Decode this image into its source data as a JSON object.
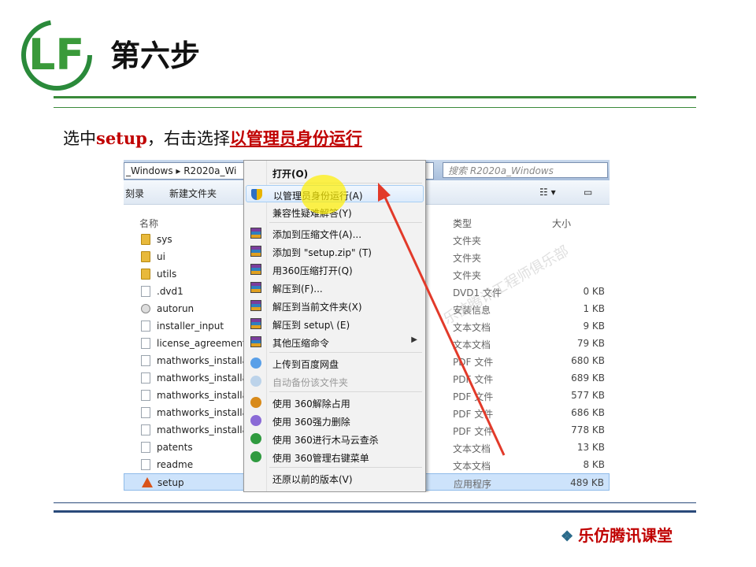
{
  "slide": {
    "title": "第六步",
    "logo_letters": "LF",
    "instruction_prefix": "选中",
    "instruction_keyword": "setup",
    "instruction_middle": "，右击选择",
    "instruction_link": "以管理员身份运行",
    "brand": "乐仿腾讯课堂",
    "watermark": "乐仿腾讯工程师俱乐部"
  },
  "explorer": {
    "address": "_Windows ▸ R2020a_Wi",
    "search_placeholder": "搜索 R2020a_Windows",
    "toolbar": {
      "burn": "刻录",
      "new_folder": "新建文件夹"
    },
    "columns": {
      "name": "名称",
      "type": "类型",
      "size": "大小"
    },
    "files": [
      {
        "name": "sys",
        "type": "文件夹",
        "size": "",
        "icon": "folder"
      },
      {
        "name": "ui",
        "type": "文件夹",
        "size": "",
        "icon": "folder"
      },
      {
        "name": "utils",
        "type": "文件夹",
        "size": "",
        "icon": "folder"
      },
      {
        "name": ".dvd1",
        "type": "DVD1 文件",
        "size": "0 KB",
        "icon": "file"
      },
      {
        "name": "autorun",
        "type": "安装信息",
        "size": "1 KB",
        "icon": "gear"
      },
      {
        "name": "installer_input",
        "type": "文本文档",
        "size": "9 KB",
        "icon": "file"
      },
      {
        "name": "license_agreement",
        "type": "文本文档",
        "size": "79 KB",
        "icon": "file"
      },
      {
        "name": "mathworks_installa",
        "type": "PDF 文件",
        "size": "680 KB",
        "icon": "file"
      },
      {
        "name": "mathworks_installa",
        "type": "PDF 文件",
        "size": "689 KB",
        "icon": "file"
      },
      {
        "name": "mathworks_installa",
        "type": "PDF 文件",
        "size": "577 KB",
        "icon": "file"
      },
      {
        "name": "mathworks_installa",
        "type": "PDF 文件",
        "size": "686 KB",
        "icon": "file"
      },
      {
        "name": "mathworks_installa",
        "type": "PDF 文件",
        "size": "778 KB",
        "icon": "file"
      },
      {
        "name": "patents",
        "type": "文本文档",
        "size": "13 KB",
        "icon": "file"
      },
      {
        "name": "readme",
        "type": "文本文档",
        "size": "8 KB",
        "icon": "file"
      },
      {
        "name": "setup",
        "type": "应用程序",
        "size": "489 KB",
        "icon": "matlab"
      }
    ]
  },
  "context_menu": {
    "items": [
      {
        "label": "打开(O)",
        "icon": "",
        "bold": true
      },
      {
        "label": "以管理员身份运行(A)",
        "icon": "shield",
        "highlight": true
      },
      {
        "label": "兼容性疑难解答(Y)",
        "icon": ""
      },
      {
        "label": "添加到压缩文件(A)...",
        "icon": "rar"
      },
      {
        "label": "添加到 \"setup.zip\" (T)",
        "icon": "rar"
      },
      {
        "label": "用360压缩打开(Q)",
        "icon": "rar"
      },
      {
        "label": "解压到(F)...",
        "icon": "rar"
      },
      {
        "label": "解压到当前文件夹(X)",
        "icon": "rar"
      },
      {
        "label": "解压到 setup\\ (E)",
        "icon": "rar"
      },
      {
        "label": "其他压缩命令",
        "icon": "rar",
        "submenu": true
      },
      {
        "label": "上传到百度网盘",
        "icon": "cloud"
      },
      {
        "label": "自动备份该文件夹",
        "icon": "cloud-disabled",
        "disabled": true
      },
      {
        "label": "使用 360解除占用",
        "icon": "360-orange"
      },
      {
        "label": "使用 360强力删除",
        "icon": "360-purple"
      },
      {
        "label": "使用 360进行木马云查杀",
        "icon": "360-green"
      },
      {
        "label": "使用 360管理右键菜单",
        "icon": "360-green"
      },
      {
        "label": "还原以前的版本(V)",
        "icon": ""
      }
    ]
  },
  "colors": {
    "accent_red": "#c00000",
    "rule_green": "#3a8a3a",
    "rule_navy": "#2a4a7a"
  }
}
